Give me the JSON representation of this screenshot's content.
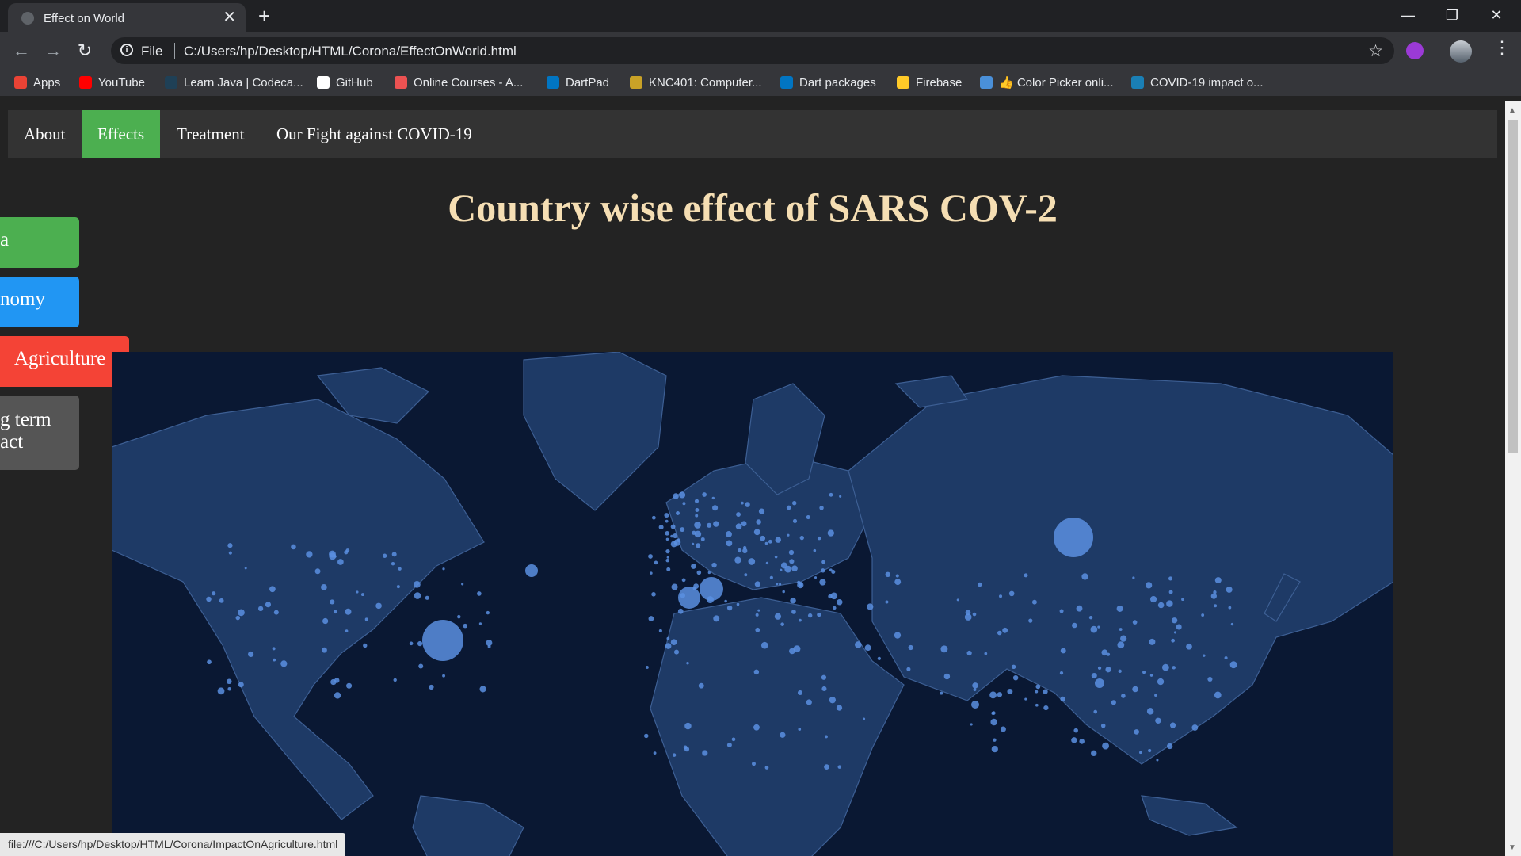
{
  "browser": {
    "tab_title": "Effect on World",
    "url_scheme": "File",
    "url": "C:/Users/hp/Desktop/HTML/Corona/EffectOnWorld.html",
    "bookmarks": [
      {
        "label": "Apps",
        "icon": "apps-grid-icon",
        "color": "#ea4335"
      },
      {
        "label": "YouTube",
        "icon": "youtube-icon",
        "color": "#ff0000"
      },
      {
        "label": "Learn Java | Codeca...",
        "icon": "codecademy-icon",
        "color": "#1f4056"
      },
      {
        "label": "GitHub",
        "icon": "github-icon",
        "color": "#ffffff"
      },
      {
        "label": "Online Courses - A...",
        "icon": "udemy-icon",
        "color": "#ec5252"
      },
      {
        "label": "DartPad",
        "icon": "dart-icon",
        "color": "#0175c2"
      },
      {
        "label": "KNC401: Computer...",
        "icon": "knc-icon",
        "color": "#c9a227"
      },
      {
        "label": "Dart packages",
        "icon": "dart-icon",
        "color": "#0175c2"
      },
      {
        "label": "Firebase",
        "icon": "firebase-icon",
        "color": "#ffca28"
      },
      {
        "label": "👍 Color Picker onli...",
        "icon": "color-picker-icon",
        "color": "#4a90d9"
      },
      {
        "label": "COVID-19 impact o...",
        "icon": "dh-icon",
        "color": "#1a7fb5"
      }
    ]
  },
  "nav": {
    "items": [
      {
        "label": "About",
        "active": false
      },
      {
        "label": "Effects",
        "active": true
      },
      {
        "label": "Treatment",
        "active": false
      },
      {
        "label": "Our Fight against COVID-19",
        "active": false
      }
    ]
  },
  "page": {
    "heading": "Country wise effect of SARS COV-2",
    "side_buttons": [
      {
        "label": "a",
        "color": "#4CAF50"
      },
      {
        "label": "nomy",
        "color": "#2196F3"
      },
      {
        "label": "Agriculture",
        "color": "#f44336"
      },
      {
        "label": "g term",
        "label2": "act",
        "color": "#555555"
      }
    ]
  },
  "map": {
    "background": "#0a1833",
    "land_color": "#1e3a66",
    "marker_color": "#5b8fe0"
  },
  "status_url": "file:///C:/Users/hp/Desktop/HTML/Corona/ImpactOnAgriculture.html"
}
